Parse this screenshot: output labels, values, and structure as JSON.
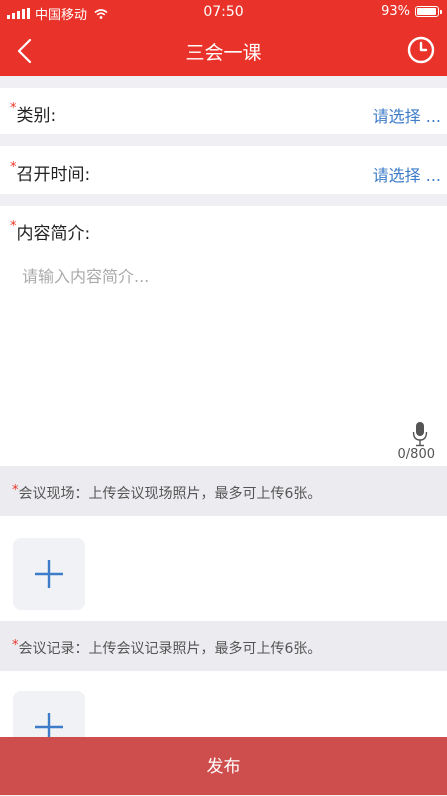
{
  "status_bar": {
    "carrier": "中国移动",
    "time": "07:50",
    "battery": "93%"
  },
  "nav": {
    "title": "三会一课"
  },
  "form": {
    "required_mark": "*",
    "category": {
      "label": "类别:",
      "value": "请选择 ..."
    },
    "meeting_time": {
      "label": "召开时间:",
      "value": "请选择 ..."
    },
    "description": {
      "label": "内容简介:",
      "placeholder": "请输入内容简介...",
      "counter": "0/800"
    }
  },
  "sections": {
    "scene_photos": {
      "text": "会议现场：上传会议现场照片，最多可上传6张。"
    },
    "record_photos": {
      "text": "会议记录：上传会议记录照片，最多可上传6张。"
    }
  },
  "footer": {
    "publish_label": "发布"
  },
  "colors": {
    "header_red": "#e9332a",
    "accent_blue": "#3d7cc9",
    "publish_button": "#ce4e4e"
  }
}
